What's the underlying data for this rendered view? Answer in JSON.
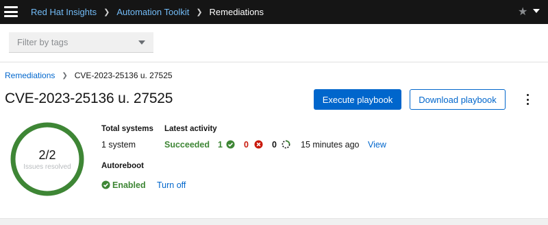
{
  "masthead": {
    "breadcrumbs": [
      "Red Hat Insights",
      "Automation Toolkit",
      "Remediations"
    ]
  },
  "filter": {
    "placeholder": "Filter by tags"
  },
  "breadcrumb": {
    "parent": "Remediations",
    "current": "CVE-2023-25136 u. 27525"
  },
  "page": {
    "title": "CVE-2023-25136 u. 27525",
    "execute_label": "Execute playbook",
    "download_label": "Download playbook"
  },
  "progress": {
    "value_text": "2/2",
    "label": "Issues resolved",
    "resolved": 2,
    "total": 2
  },
  "systems": {
    "label": "Total systems",
    "value": "1 system"
  },
  "activity": {
    "label": "Latest activity",
    "status": "Succeeded",
    "success_count": "1",
    "failed_count": "0",
    "running_count": "0",
    "time": "15 minutes ago",
    "view_label": "View"
  },
  "autoreboot": {
    "label": "Autoreboot",
    "status": "Enabled",
    "toggle_label": "Turn off"
  },
  "colors": {
    "success": "#3e8635",
    "danger": "#c9190b",
    "link": "#0066cc",
    "masthead": "#151515"
  },
  "icons": [
    "menu-icon",
    "star-icon",
    "caret-down-icon",
    "check-circle-icon",
    "times-circle-icon",
    "in-progress-icon",
    "kebab-icon"
  ]
}
